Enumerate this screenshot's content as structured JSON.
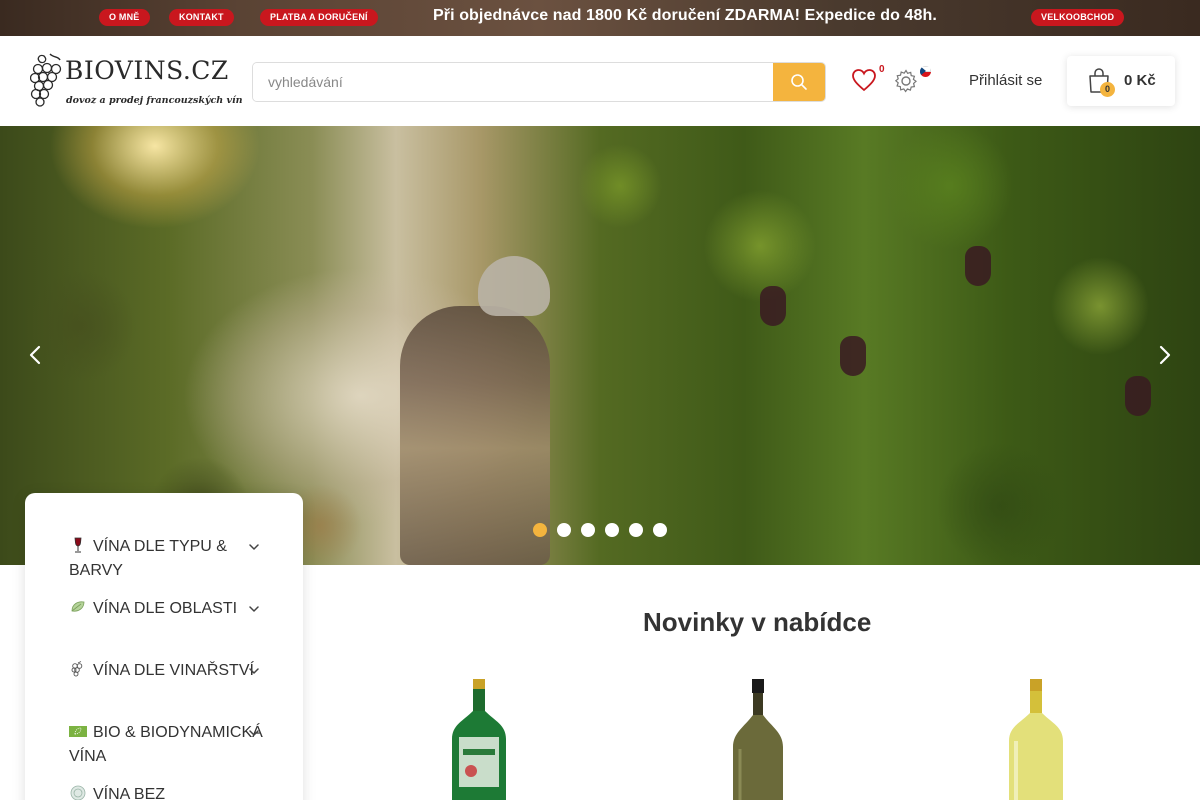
{
  "topbar": {
    "links": [
      "O MNĚ",
      "KONTAKT",
      "PLATBA A DORUČENÍ"
    ],
    "promo": "Při objednávce nad 1800 Kč doručení ZDARMA!  Expedice do 48h.",
    "wholesale": "VELKOOBCHOD",
    "accent_color": "#c9171e"
  },
  "header": {
    "logo_text": "BIOVINS.CZ",
    "logo_tagline": "dovoz a prodej francouzských vín",
    "search_placeholder": "vyhledávání",
    "search_icon": "search-icon",
    "wishlist_count": "0",
    "login_label": "Přihlásit se",
    "cart_count": "0",
    "cart_total": "0 Kč",
    "button_color": "#f4b43e"
  },
  "hero": {
    "slide_count": 6,
    "active_slide": 1
  },
  "sidebar": {
    "items": [
      {
        "label": "VÍNA DLE TYPU & BARVY",
        "icon": "wine-glass-icon"
      },
      {
        "label": "VÍNA DLE OBLASTI",
        "icon": "leaf-icon"
      },
      {
        "label": "VÍNA DLE VINAŘSTVÍ",
        "icon": "grapes-icon"
      },
      {
        "label": "BIO & BIODYNAMICKÁ VÍNA",
        "icon": "eu-bio-leaf-icon"
      },
      {
        "label": "VÍNA BEZ",
        "icon": "no-sulfite-icon"
      }
    ]
  },
  "main": {
    "section_title": "Novinky v nabídce"
  }
}
